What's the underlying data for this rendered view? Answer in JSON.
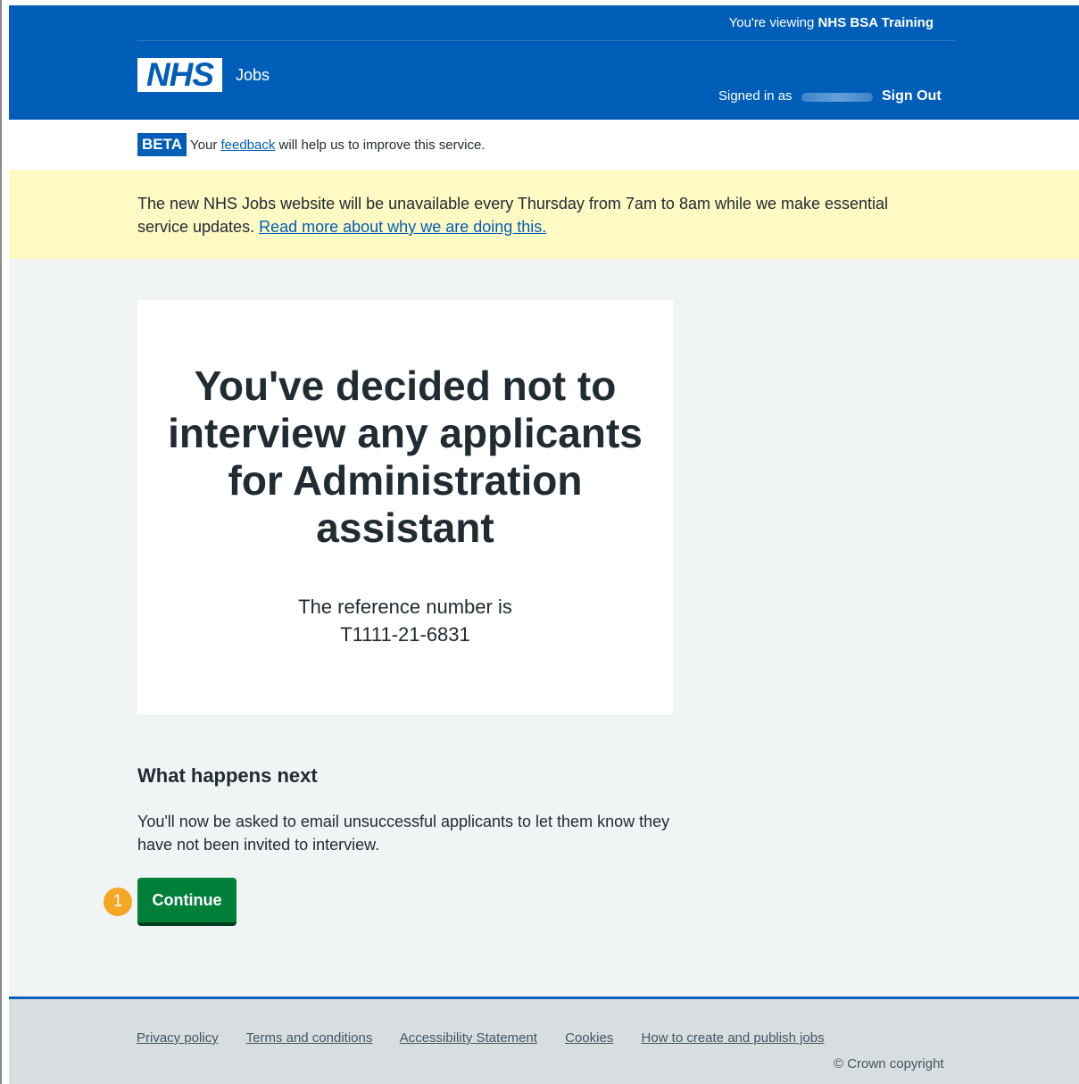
{
  "header": {
    "viewing_prefix": "You're viewing",
    "viewing_org": "NHS BSA Training",
    "logo_text": "NHS",
    "service_name": "Jobs",
    "signed_in_label": "Signed in as",
    "sign_out": "Sign Out"
  },
  "beta": {
    "tag": "BETA",
    "text_before": "Your",
    "link": "feedback",
    "text_after": "will help us to improve this service."
  },
  "notice": {
    "text": "The new NHS Jobs website will be unavailable every Thursday from 7am to 8am while we make essential service updates.",
    "link": "Read more about why we are doing this."
  },
  "confirmation": {
    "title": "You've decided not to interview any applicants for Administration assistant",
    "reference_label": "The reference number is",
    "reference_number": "T1111-21-6831"
  },
  "next": {
    "title": "What happens next",
    "body": "You'll now be asked to email unsuccessful applicants to let them know they have not been invited to interview."
  },
  "step_badge": "1",
  "continue_label": "Continue",
  "footer": {
    "links": [
      "Privacy policy",
      "Terms and conditions",
      "Accessibility Statement",
      "Cookies",
      "How to create and publish jobs"
    ],
    "copyright": "© Crown copyright"
  },
  "colors": {
    "nhs_blue": "#005eb8",
    "button_green": "#007f3b",
    "notice_yellow": "#fff9c4",
    "badge_orange": "#f5a623"
  }
}
